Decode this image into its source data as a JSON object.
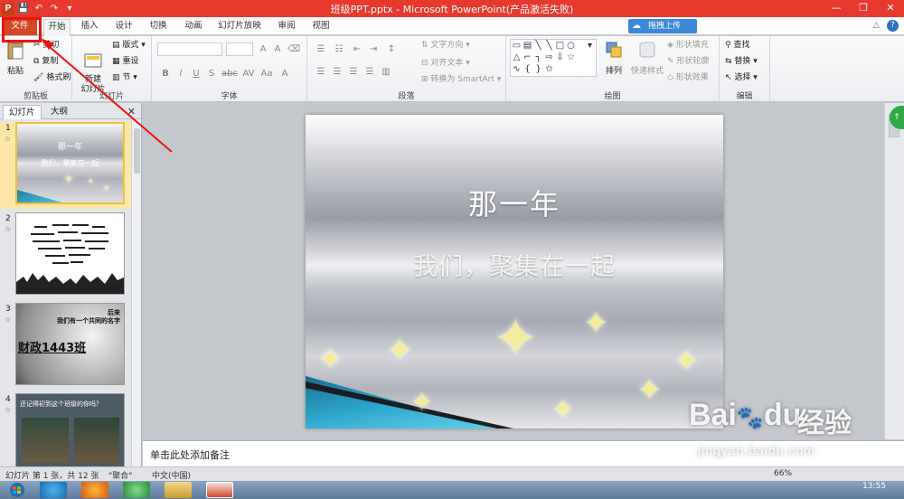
{
  "window": {
    "title": "班级PPT.pptx - Microsoft PowerPoint(产品激活失败)",
    "controls": [
      "—",
      "❐",
      "✕"
    ]
  },
  "qat": {
    "logo": "P",
    "items": [
      "💾",
      "↶",
      "↷",
      "▾"
    ]
  },
  "tabs": [
    "文件",
    "开始",
    "插入",
    "设计",
    "切换",
    "动画",
    "幻灯片放映",
    "审阅",
    "视图"
  ],
  "upload_label": "拖拽上传",
  "ribbon": {
    "clipboard": {
      "label": "剪贴板",
      "paste": "粘贴",
      "cut": "剪切",
      "copy": "复制",
      "format": "格式刷"
    },
    "slides": {
      "label": "幻灯片",
      "new_slide": "新建\n幻灯片",
      "layout": "版式",
      "reset": "重设",
      "section": "节"
    },
    "font": {
      "label": "字体",
      "buttons": [
        "B",
        "I",
        "U",
        "S",
        "abc",
        "AV",
        "Aa",
        "A"
      ]
    },
    "paragraph": {
      "label": "段落",
      "text_direction": "文字方向",
      "align_text": "对齐文本",
      "smartart": "转换为 SmartArt"
    },
    "drawing": {
      "label": "绘图",
      "arrange": "排列",
      "quick_styles": "快速样式",
      "fill": "形状填充",
      "outline": "形状轮廓",
      "effects": "形状效果"
    },
    "editing": {
      "label": "编辑",
      "find": "查找",
      "replace": "替换",
      "select": "选择"
    }
  },
  "pane": {
    "tabs": [
      "幻灯片",
      "大纲"
    ],
    "close": "✕",
    "slides": [
      {
        "num": "1",
        "marker": "☆",
        "title": "那一年",
        "subtitle": "我们，聚集在一起"
      },
      {
        "num": "2",
        "marker": "☆"
      },
      {
        "num": "3",
        "marker": "☆",
        "title": "财政1443班",
        "note": "后来\n我们有一个共同的名字"
      },
      {
        "num": "4",
        "marker": "☆",
        "title": "还记得初到这个班级的你吗？"
      }
    ]
  },
  "slide": {
    "title": "那一年",
    "subtitle": "我们，聚集在一起"
  },
  "notes_placeholder": "单击此处添加备注",
  "status": {
    "slide_info": "幻灯片 第 1 张，共 12 张",
    "theme": "\"聚合\"",
    "language": "中文(中国)",
    "zoom": "66%"
  },
  "taskbar": {
    "time": "13:55"
  },
  "watermark": {
    "brand": "Bai",
    "brand2": "du",
    "zh": "经验",
    "sub": "jingyan.baidu.com"
  },
  "colors": {
    "file_tab": "#d24726",
    "title_bar": "#e8392f",
    "annotation": "#ee1111"
  }
}
